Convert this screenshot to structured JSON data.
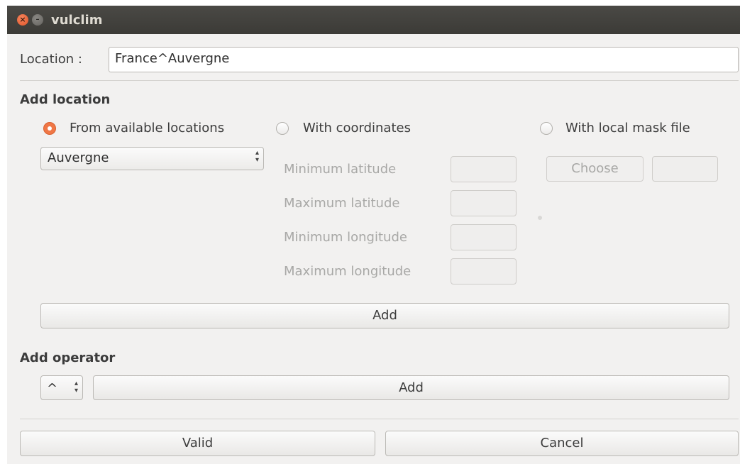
{
  "window": {
    "title": "vulclim"
  },
  "location_field": {
    "label": "Location :",
    "value": "France^Auvergne"
  },
  "add_location": {
    "heading": "Add location",
    "radio_available": {
      "label": "From available locations",
      "selected": true
    },
    "radio_coordinates": {
      "label": "With coordinates",
      "selected": false
    },
    "radio_mask": {
      "label": "With local mask file",
      "selected": false
    },
    "location_select": {
      "value": "Auvergne"
    },
    "coords": {
      "min_lat_label": "Minimum latitude",
      "max_lat_label": "Maximum latitude",
      "min_lon_label": "Minimum longitude",
      "max_lon_label": "Maximum longitude"
    },
    "choose_label": "Choose",
    "add_label": "Add"
  },
  "add_operator": {
    "heading": "Add operator",
    "operator_value": "^",
    "add_label": "Add"
  },
  "footer": {
    "valid_label": "Valid",
    "cancel_label": "Cancel"
  },
  "colors": {
    "accent": "#f07746",
    "titlebar": "#3c3b37",
    "window_bg": "#f2f1f0"
  }
}
